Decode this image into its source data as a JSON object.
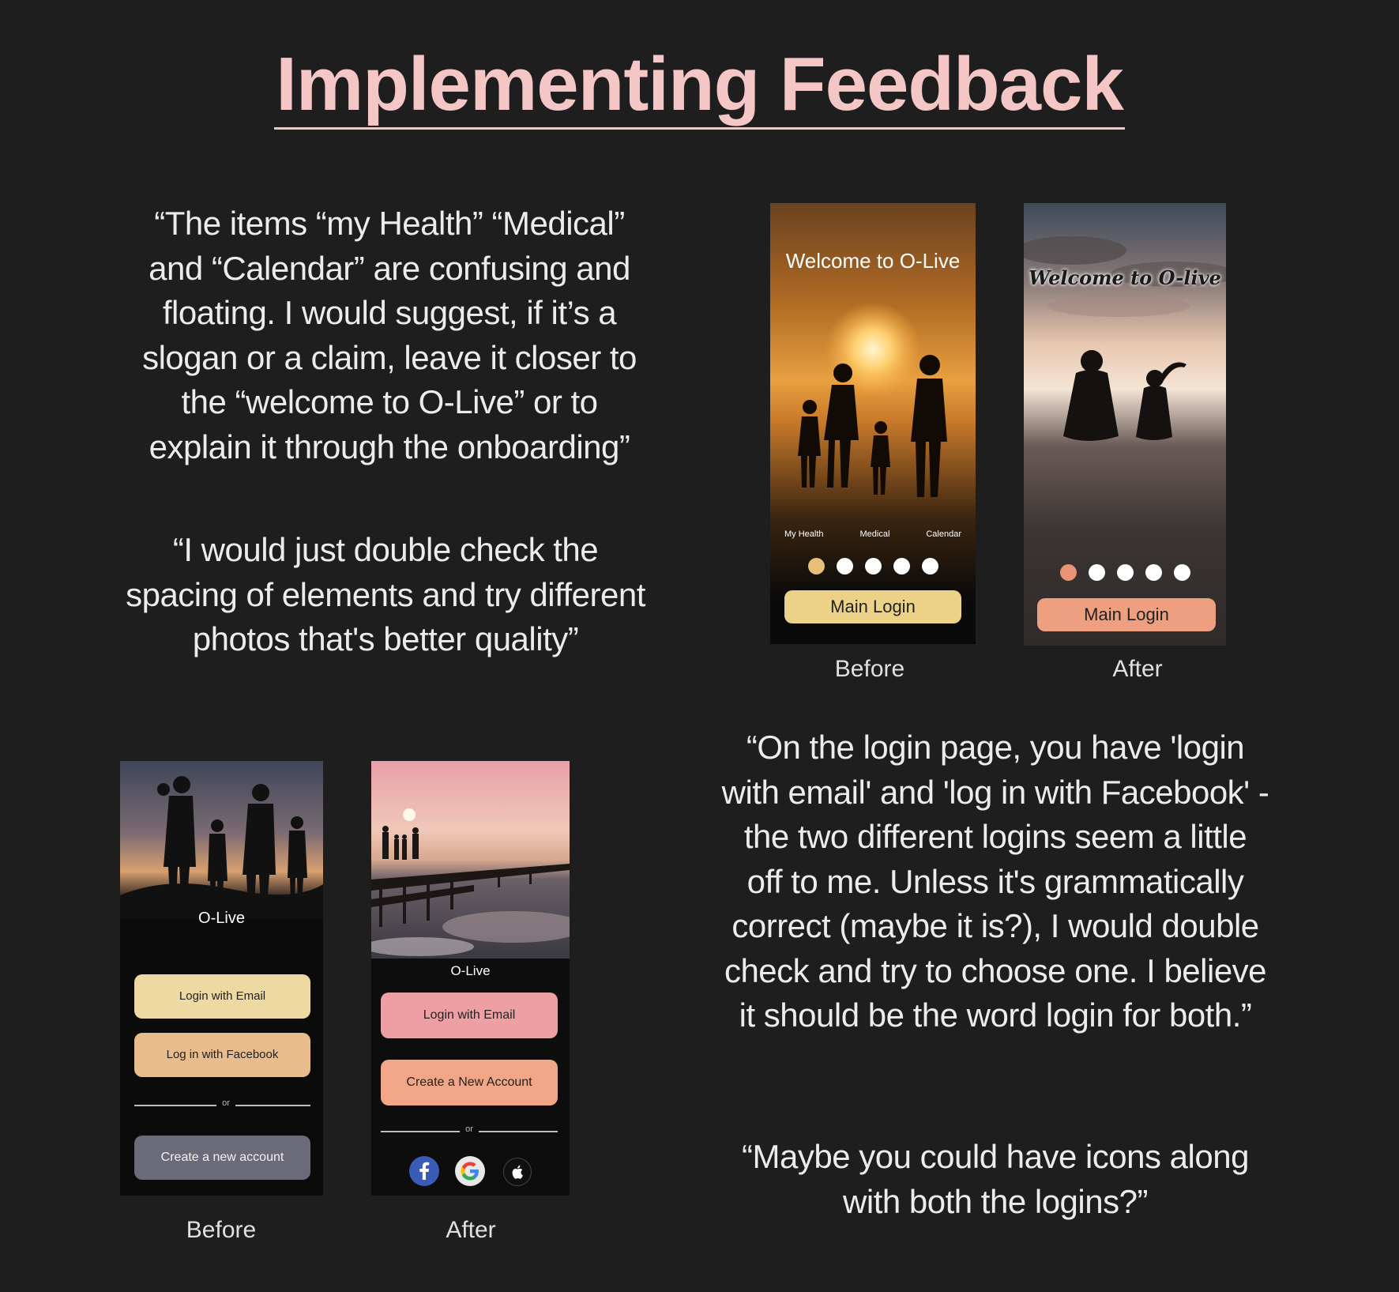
{
  "title": "Implementing Feedback",
  "quotes": {
    "q1": [
      "“The items “my Health” “Medical”",
      "and “Calendar” are confusing and",
      "floating. I would suggest, if it’s a",
      "slogan or a claim, leave it closer to",
      "the “welcome to O-Live” or to",
      "explain it through the onboarding”"
    ],
    "q2": [
      "“I would just double check the",
      "spacing of elements and try different",
      "photos that's better quality”"
    ],
    "q3": [
      "“On the login page, you have 'login",
      "with email' and 'log in with Facebook' -",
      "the two different logins seem a little",
      "off to me. Unless it's grammatically",
      "correct (maybe it is?), I would double",
      "check and try to choose one. I believe",
      "it should be the word login for both.”"
    ],
    "q4": [
      "“Maybe you could have icons along",
      "with both the logins?”"
    ]
  },
  "welcome_before": {
    "title": "Welcome to O-Live",
    "tabs": [
      "My Health",
      "Medical",
      "Calendar"
    ],
    "dots_count": 5,
    "active_dot_color": "#e7c078",
    "button": "Main Login",
    "button_color": "#ecd289",
    "caption": "Before"
  },
  "welcome_after": {
    "title": "Welcome to O-live",
    "dots_count": 5,
    "active_dot_color": "#e99477",
    "button": "Main Login",
    "button_color": "#ee9f80",
    "caption": "After"
  },
  "login_before": {
    "app_name": "O-Live",
    "email_button": "Login with Email",
    "facebook_button": "Log in with Facebook",
    "or_text": "or",
    "create_button": "Create a new account",
    "caption": "Before"
  },
  "login_after": {
    "app_name": "O-Live",
    "email_button": "Login with Email",
    "create_button": "Create a New Account",
    "or_text": "or",
    "social_icons": [
      "facebook-icon",
      "google-icon",
      "apple-icon"
    ],
    "caption": "After"
  }
}
